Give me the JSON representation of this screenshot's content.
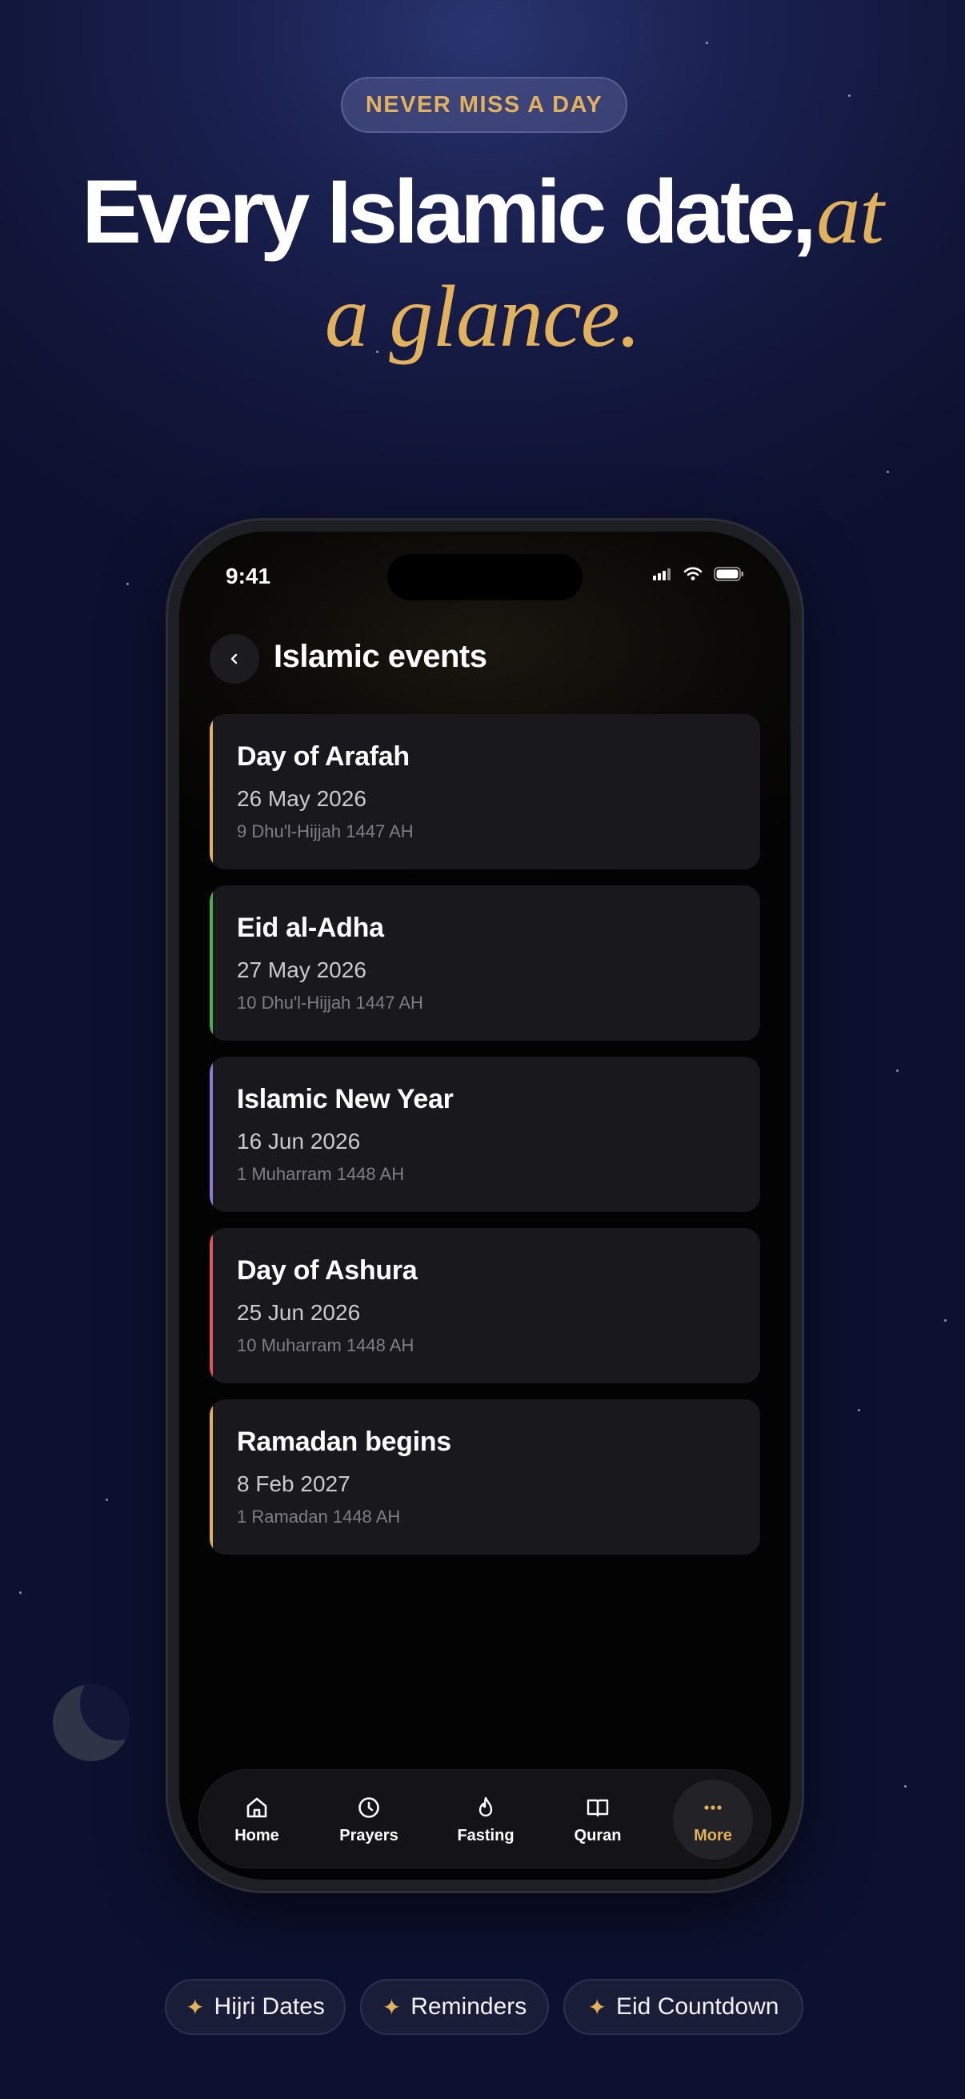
{
  "badge": {
    "label": "NEVER MISS A DAY"
  },
  "headline": {
    "bold_text": "Every Islamic date",
    "comma": ",",
    "italic_1": "at",
    "italic_2": "a glance."
  },
  "status_bar": {
    "time": "9:41"
  },
  "screen": {
    "title": "Islamic events"
  },
  "events": [
    {
      "title": "Day of Arafah",
      "date": "26 May 2026",
      "hijri": "9 Dhu'l-Hijjah 1447 AH",
      "accent": "#e2b15c"
    },
    {
      "title": "Eid al-Adha",
      "date": "27 May 2026",
      "hijri": "10 Dhu'l-Hijjah 1447 AH",
      "accent": "#4caf50"
    },
    {
      "title": "Islamic New Year",
      "date": "16 Jun 2026",
      "hijri": "1 Muharram 1448 AH",
      "accent": "#8f7ad8"
    },
    {
      "title": "Day of Ashura",
      "date": "25 Jun 2026",
      "hijri": "10 Muharram 1448 AH",
      "accent": "#e05757"
    },
    {
      "title": "Ramadan begins",
      "date": "8 Feb 2027",
      "hijri": "1 Ramadan 1448 AH",
      "accent": "#e2b15c"
    }
  ],
  "tabs": [
    {
      "label": "Home",
      "icon": "home-icon"
    },
    {
      "label": "Prayers",
      "icon": "clock-icon"
    },
    {
      "label": "Fasting",
      "icon": "flame-icon"
    },
    {
      "label": "Quran",
      "icon": "book-icon"
    },
    {
      "label": "More",
      "icon": "more-icon",
      "active": true
    }
  ],
  "chips": [
    {
      "label": "Hijri Dates",
      "icon": "sparkle-icon"
    },
    {
      "label": "Reminders",
      "icon": "sparkle-icon"
    },
    {
      "label": "Eid Countdown",
      "icon": "sparkle-icon"
    }
  ],
  "colors": {
    "gold": "#e2b15c",
    "background": "#11163a",
    "card": "#18181d"
  }
}
